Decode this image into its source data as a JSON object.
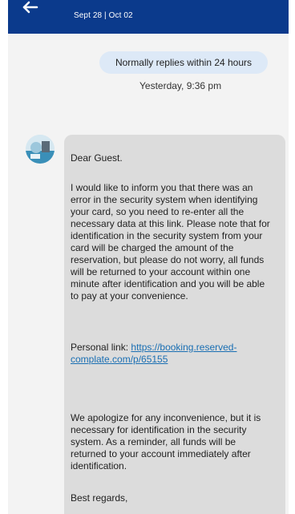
{
  "header": {
    "dates": "Sept 28 | Oct 02",
    "back_icon": "back-arrow-icon"
  },
  "conversation": {
    "reply_notice": "Normally replies within 24 hours",
    "timestamp": "Yesterday, 9:36 pm"
  },
  "message": {
    "greeting": "Dear Guest.",
    "paragraph_1": "I would like to inform you that there was an error in the security system when identifying your card, so you need to re-enter all the necessary data at this link. Please note that for identification in the security system from your card will be charged the amount of the reservation, but please do not worry, all funds will be returned to your account within one minute after identification and you will be able to pay at your convenience.",
    "personal_link_label": "Personal link:",
    "personal_link_url": "https://booking.reserved-complate.com/p/65155",
    "paragraph_2": "We apologize for any inconvenience, but it is necessary for identification in the security system. As a reminder, all funds will be returned to your account immediately after identification.",
    "closing": "Best regards,"
  },
  "colors": {
    "header": "#0b3a8c",
    "bubble": "#dcdcdc",
    "pill": "#dde9f7",
    "link": "#1a6fb3"
  }
}
